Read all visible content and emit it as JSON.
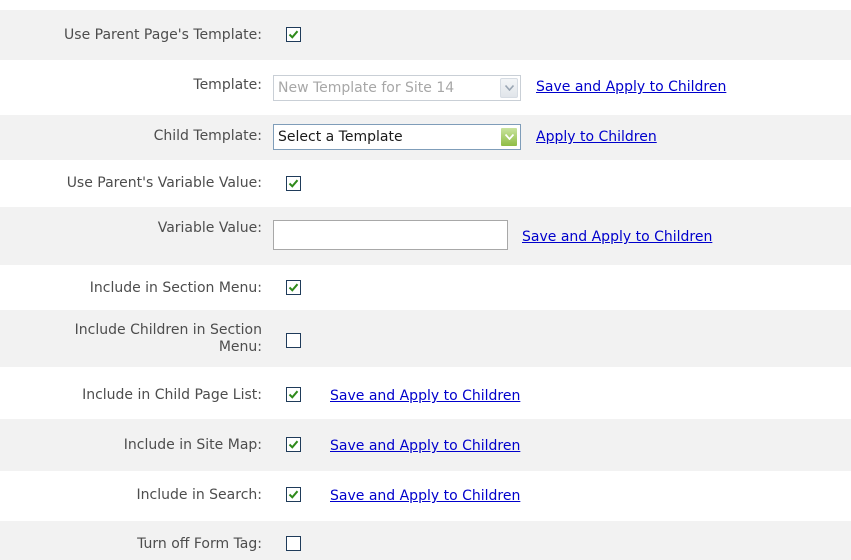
{
  "rows": [
    {
      "label": "Use Parent Page's Template:",
      "checked": true
    },
    {
      "label": "Template:",
      "select_value": "New Template for Site 14",
      "link": "Save and Apply to Children"
    },
    {
      "label": "Child Template:",
      "select_value": "Select a Template",
      "link": "Apply to Children"
    },
    {
      "label": "Use Parent's Variable Value:",
      "checked": true
    },
    {
      "label": "Variable Value:",
      "input_value": "",
      "link": "Save and Apply to Children"
    },
    {
      "label": "Include in Section Menu:",
      "checked": true
    },
    {
      "label_line1": "Include Children in Section",
      "label_line2": "Menu:",
      "checked": false
    },
    {
      "label": "Include in Child Page List:",
      "checked": true,
      "link": "Save and Apply to Children"
    },
    {
      "label": "Include in Site Map:",
      "checked": true,
      "link": "Save and Apply to Children"
    },
    {
      "label": "Include in Search:",
      "checked": true,
      "link": "Save and Apply to Children"
    },
    {
      "label": "Turn off Form Tag:",
      "checked": false
    }
  ],
  "colors": {
    "row_shade": "#f2f2f2",
    "label_text": "#4d4d4d",
    "link": "#0000cc",
    "checkmark": "#2f8a1a",
    "select_arrow": "#8fbd45"
  },
  "icons": {
    "checkmark": "check-icon",
    "dropdown": "chevron-down-icon"
  }
}
